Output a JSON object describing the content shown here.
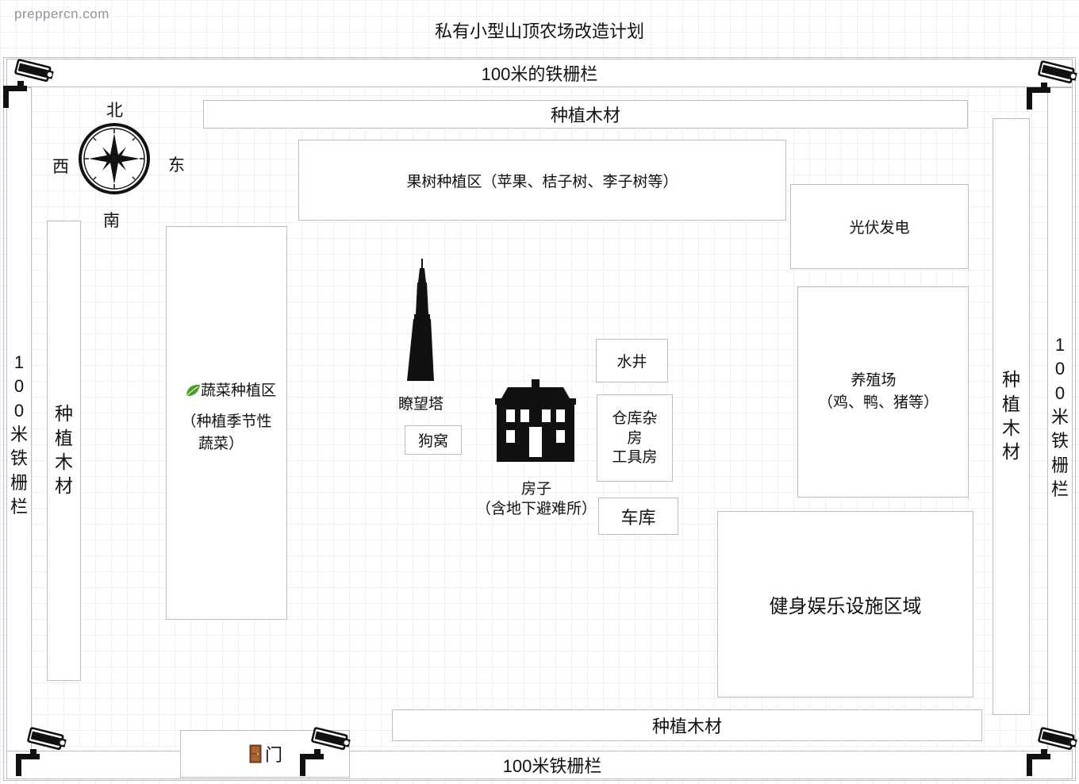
{
  "watermark": "preppercn.com",
  "title": "私有小型山顶农场改造计划",
  "compass": {
    "north": "北",
    "south": "南",
    "east": "东",
    "west": "西"
  },
  "fences": {
    "top": "100米的铁栅栏",
    "bottom": "100米铁栅栏",
    "left": [
      "1",
      "0",
      "0",
      "米",
      "铁",
      "栅",
      "栏"
    ],
    "right": [
      "1",
      "0",
      "0",
      "米",
      "铁",
      "栅",
      "栏"
    ]
  },
  "timber": {
    "top": "种植木材",
    "bottom": "种植木材",
    "left": [
      "种",
      "植",
      "木",
      "材"
    ],
    "right": [
      "种",
      "植",
      "木",
      "材"
    ]
  },
  "zones": {
    "orchard": "果树种植区（苹果、桔子树、李子树等）",
    "solar": "光伏发电",
    "vegetable_title": "蔬菜种植区",
    "vegetable_line2": "（种植季节性",
    "vegetable_line3": "蔬菜）",
    "livestock_title": "养殖场",
    "livestock_sub": "（鸡、鸭、猪等）",
    "fitness": "健身娱乐设施区域",
    "watchtower": "瞭望塔",
    "doghouse": "狗窝",
    "well": "水井",
    "storage": [
      "仓库杂",
      "房",
      "工具房"
    ],
    "house_title": "房子",
    "house_sub": "（含地下避难所）",
    "garage": "车库",
    "gate": "门"
  },
  "icons": [
    "cctv-camera-icon",
    "compass-icon",
    "tower-icon",
    "house-icon",
    "leaf-icon",
    "door-icon"
  ]
}
